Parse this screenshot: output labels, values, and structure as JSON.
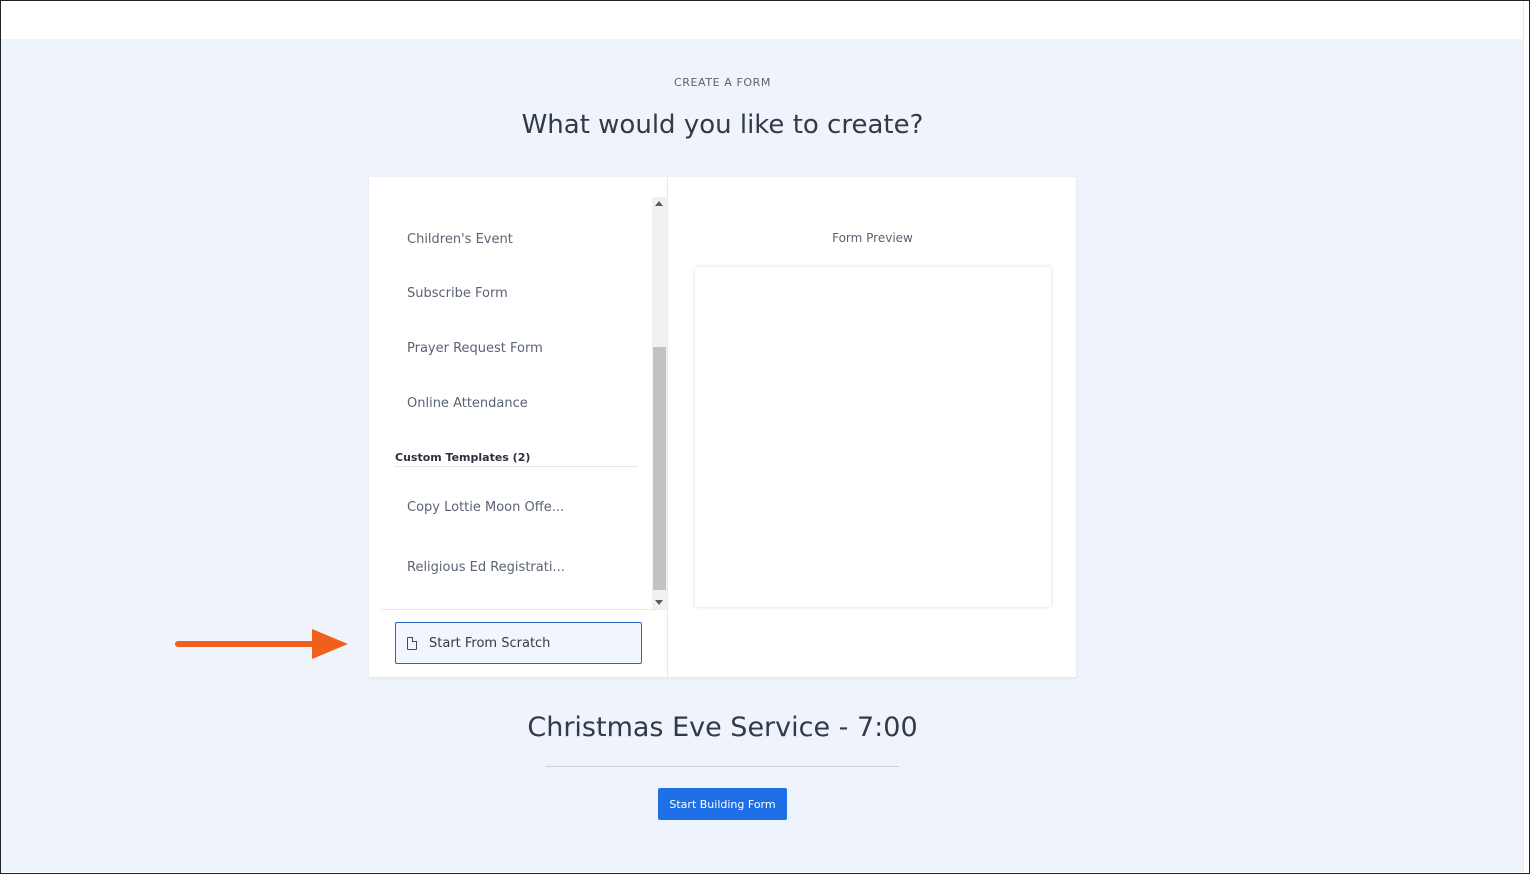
{
  "header": {
    "eyebrow": "CREATE A FORM",
    "title": "What would you like to create?"
  },
  "template_list": {
    "items": [
      {
        "label": "Children's Event"
      },
      {
        "label": "Subscribe Form"
      },
      {
        "label": "Prayer Request Form"
      },
      {
        "label": "Online Attendance"
      }
    ],
    "custom_section_title": "Custom Templates (2)",
    "custom_items": [
      {
        "label": "Copy Lottie Moon Offe..."
      },
      {
        "label": "Religious Ed Registrati..."
      }
    ]
  },
  "scratch_button": {
    "label": "Start From Scratch",
    "icon": "document-icon"
  },
  "preview": {
    "title": "Form Preview"
  },
  "form_name": "Christmas Eve Service - 7:00",
  "start_button": {
    "label": "Start Building Form"
  },
  "colors": {
    "canvas": "#eff3fb",
    "primary": "#1f6fe8",
    "annotation_arrow": "#f0601c",
    "selected_border": "#2d63c8"
  }
}
